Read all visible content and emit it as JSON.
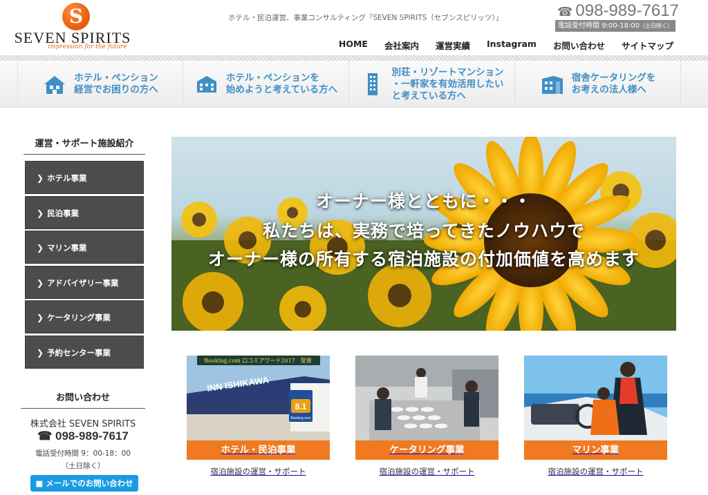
{
  "header": {
    "logo_letter": "S",
    "logo_name": "SEVEN SPIRITS",
    "logo_tagline": "impression for the future",
    "tagline": "ホテル・民泊運営、事業コンサルティング「SEVEN SPIRITS（セブンスピリッツ）」",
    "phone": "098-989-7617",
    "hours_label": "電話受付時間 9:00-18:00",
    "hours_note": "（土日除く）",
    "nav": [
      "HOME",
      "会社案内",
      "運営実績",
      "Instagram",
      "お問い合わせ",
      "サイトマップ"
    ]
  },
  "categories": [
    {
      "line1": "ホテル・ペンション",
      "line2": "経営でお困りの方へ",
      "line3": ""
    },
    {
      "line1": "ホテル・ペンションを",
      "line2": "始めようと考えている方へ",
      "line3": ""
    },
    {
      "line1": "別荘・リゾートマンション",
      "line2": "・一軒家を有効活用したい",
      "line3": "と考えている方へ"
    },
    {
      "line1": "宿舎ケータリングを",
      "line2": "お考えの法人様へ",
      "line3": ""
    }
  ],
  "sidebar": {
    "title": "運営・サポート施設紹介",
    "items": [
      "ホテル事業",
      "民泊事業",
      "マリン事業",
      "アドバイザリー事業",
      "ケータリング事業",
      "予約センター事業"
    ],
    "contact_title": "お問い合わせ",
    "company": "株式会社 SEVEN SPIRITS",
    "phone": "098-989-7617",
    "hours": "電話受付時間 9：00-18：00",
    "hours_note": "（土日除く）",
    "mail_button": "メールでのお問い合わせ"
  },
  "hero": {
    "line1": "オーナー様とともに・・・",
    "line2": "私たちは、実務で培ってきたノウハウで",
    "line3": "オーナー様の所有する宿泊施設の付加価値を高めます"
  },
  "cards": [
    {
      "title": "ホテル・民泊事業",
      "caption": "宿泊施設の運営・サポート",
      "award": "Booking.com 口コミアワード2017　受賞",
      "sign": "INN ISHIKAWA",
      "score": "8.1",
      "score_brand": "Booking.com"
    },
    {
      "title": "ケータリング事業",
      "caption": "宿泊施設の運営・サポート"
    },
    {
      "title": "マリン事業",
      "caption": "宿泊施設の運営・サポート"
    }
  ],
  "colors": {
    "accent_blue": "#3f8fc6",
    "orange": "#f07a1f",
    "sidebar_dark": "#4c4c4c",
    "mail_blue": "#1a9be4"
  }
}
